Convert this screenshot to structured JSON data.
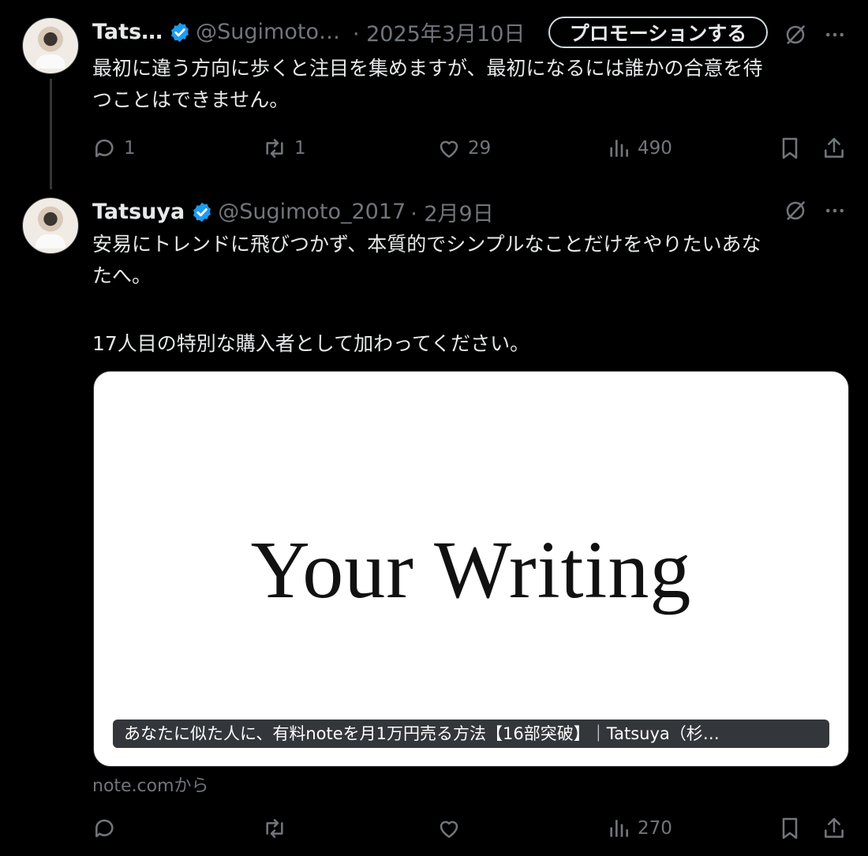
{
  "tweets": [
    {
      "name": "Tats…",
      "handle": "@Sugimoto…",
      "date": "· 2025年3月10日",
      "promote_label": "プロモーションする",
      "lines": [
        "最初に違う方向に歩くと注目を集めますが、最初になるには誰かの合意を待",
        "つことはできません。"
      ],
      "stats": {
        "replies": "1",
        "reposts": "1",
        "likes": "29",
        "views": "490"
      }
    },
    {
      "name": "Tatsuya",
      "handle": "@Sugimoto_2017",
      "date": "· 2月9日",
      "lines": [
        "安易にトレンドに飛びつかず、本質的でシンプルなことだけをやりたいあな",
        "たへ。",
        "",
        "17人目の特別な購入者として加わってください。"
      ],
      "card": {
        "image_text": "Your Writing",
        "caption": "あなたに似た人に、有料noteを月1万円売る方法【16部突破】｜Tatsuya（杉…",
        "source": "note.comから"
      },
      "stats": {
        "replies": "",
        "reposts": "",
        "likes": "",
        "views": "270"
      }
    }
  ],
  "colors": {
    "background": "#000000",
    "text": "#e7e9ea",
    "muted": "#71767b",
    "verified": "#1d9bf0"
  },
  "icons": [
    "verified-badge-icon",
    "grok-icon",
    "more-icon",
    "reply-icon",
    "repost-icon",
    "like-icon",
    "views-icon",
    "bookmark-icon",
    "share-icon"
  ]
}
